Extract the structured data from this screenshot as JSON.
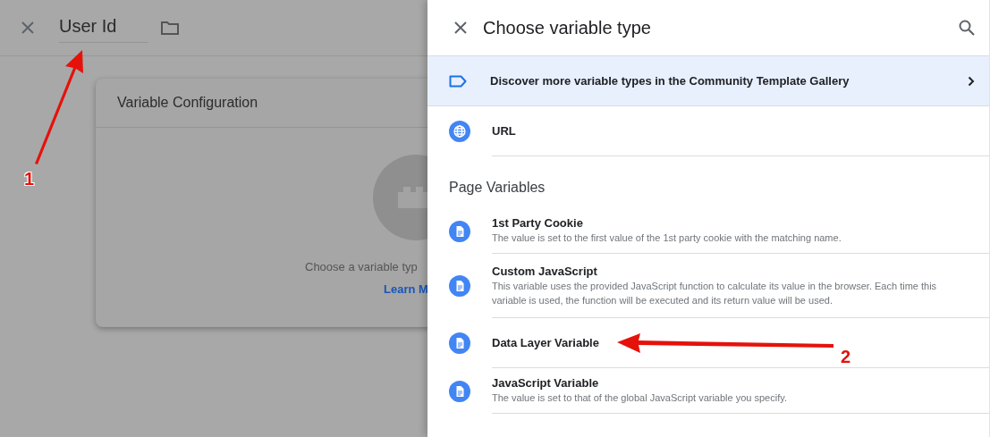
{
  "header": {
    "name_field": "User Id"
  },
  "card": {
    "title": "Variable Configuration",
    "hint": "Choose a variable typ",
    "link": "Learn M"
  },
  "drawer": {
    "title": "Choose variable type",
    "banner": "Discover more variable types in the Community Template Gallery",
    "items": [
      {
        "kind": "globe",
        "title": "URL"
      }
    ],
    "sections": [
      {
        "title": "Page Variables",
        "items": [
          {
            "kind": "document",
            "title": "1st Party Cookie",
            "description": "The value is set to the first value of the 1st party cookie with the matching name."
          },
          {
            "kind": "document",
            "title": "Custom JavaScript",
            "description": "This variable uses the provided JavaScript function to calculate its value in the browser. Each time this variable is used, the function will be executed and its return value will be used."
          },
          {
            "kind": "document",
            "title": "Data Layer Variable"
          },
          {
            "kind": "document",
            "title": "JavaScript Variable",
            "description": "The value is set to that of the global JavaScript variable you specify."
          }
        ]
      }
    ]
  },
  "annotations": [
    {
      "label": "1"
    },
    {
      "label": "2"
    }
  ]
}
